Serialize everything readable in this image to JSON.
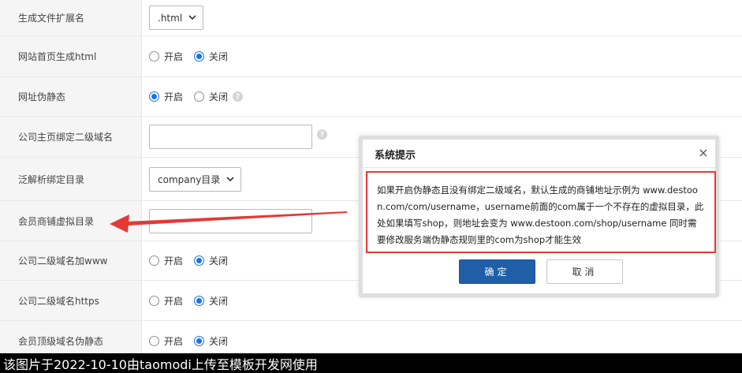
{
  "settings": {
    "file_ext": {
      "label": "生成文件扩展名",
      "value": ".html"
    },
    "homepage_html": {
      "label": "网站首页生成html",
      "on": "开启",
      "off": "关闭"
    },
    "url_rewrite": {
      "label": "网址伪静态",
      "on": "开启",
      "off": "关闭"
    },
    "company_subdomain": {
      "label": "公司主页绑定二级域名"
    },
    "wildcard_dir": {
      "label": "泛解析绑定目录",
      "value": "company目录"
    },
    "shop_virtual_dir": {
      "label": "会员商铺虚拟目录"
    },
    "subdomain_www": {
      "label": "公司二级域名加www",
      "on": "开启",
      "off": "关闭"
    },
    "subdomain_https": {
      "label": "公司二级域名https",
      "on": "开启",
      "off": "关闭"
    },
    "topdomain_rewrite": {
      "label": "会员顶级域名伪静态",
      "on": "开启",
      "off": "关闭"
    }
  },
  "dialog": {
    "title": "系统提示",
    "close": "×",
    "message": "如果开启伪静态且没有绑定二级域名，默认生成的商铺地址示例为 www.destoon.com/com/username，username前面的com属于一个不存在的虚拟目录，此处如果填写shop，则地址会变为 www.destoon.com/shop/username 同时需要修改服务端伪静态规则里的com为shop才能生效",
    "ok_label": "确定",
    "cancel_label": "取消"
  },
  "watermark": "该图片于2022-10-10由taomodi上传至模板开发网使用",
  "icons": {
    "help": "?",
    "chevron": "⌄"
  },
  "colors": {
    "accent": "#1a73e8",
    "ok_button": "#1e5fa8",
    "highlight": "#e53935"
  }
}
